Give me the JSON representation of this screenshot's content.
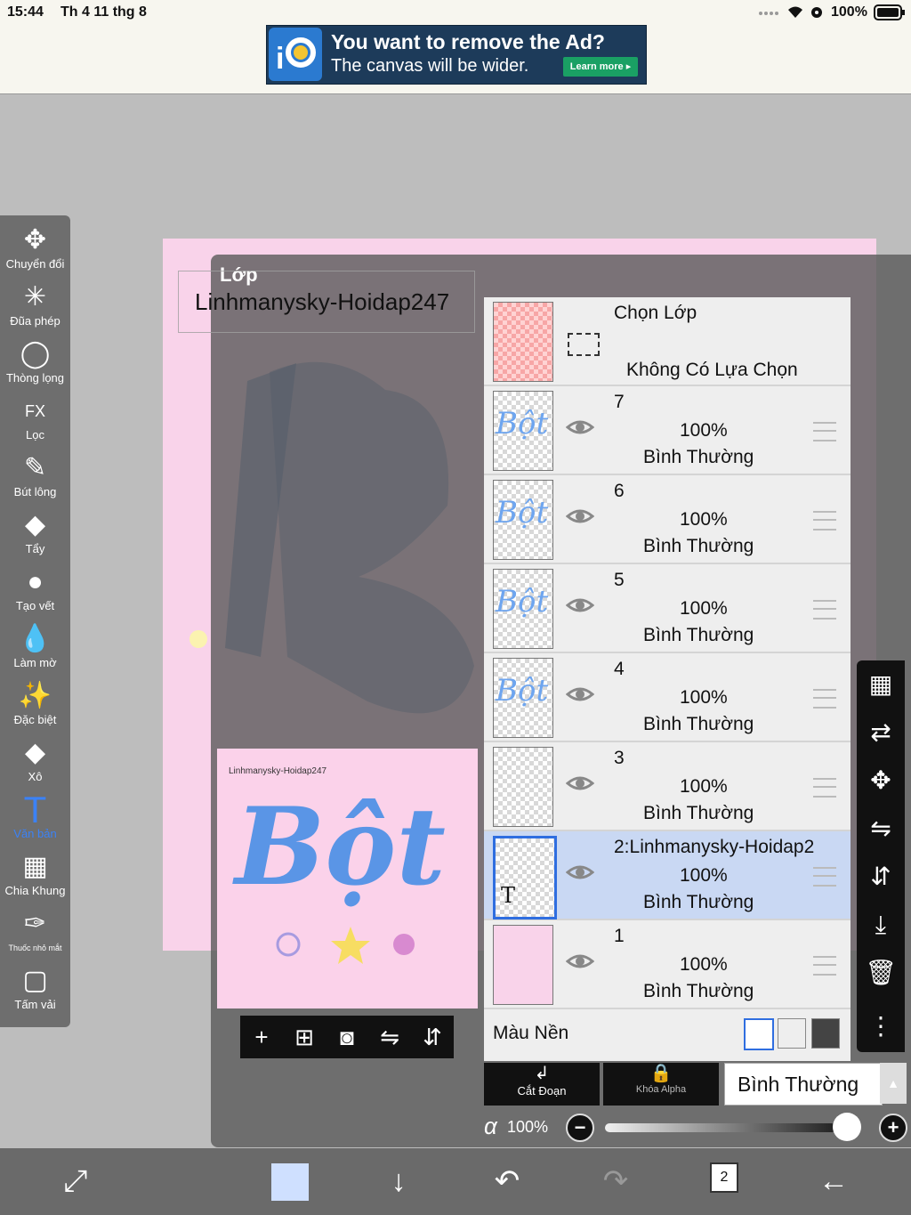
{
  "status": {
    "time": "15:44",
    "date": "Th 4 11 thg 8",
    "battery": "100%"
  },
  "ad": {
    "title": "You want to remove the Ad?",
    "subtitle": "The canvas will be wider.",
    "cta": "Learn more ▸",
    "logo_icon": "ibis-paint-logo-icon"
  },
  "toolbar": {
    "tools": [
      {
        "label": "Chuyển đổi",
        "icon": "move-icon",
        "glyph": "✥"
      },
      {
        "label": "Đũa phép",
        "icon": "magic-wand-icon",
        "glyph": "✳"
      },
      {
        "label": "Thòng lọng",
        "icon": "lasso-icon",
        "glyph": "◯"
      },
      {
        "label": "Lọc",
        "icon": "fx-filter-icon",
        "glyph": "FX"
      },
      {
        "label": "Bút lông",
        "icon": "brush-icon",
        "glyph": "✎"
      },
      {
        "label": "Tẩy",
        "icon": "eraser-icon",
        "glyph": "◆"
      },
      {
        "label": "Tạo vết",
        "icon": "smudge-icon",
        "glyph": "●"
      },
      {
        "label": "Làm mờ",
        "icon": "blur-drop-icon",
        "glyph": "💧"
      },
      {
        "label": "Đặc biệt",
        "icon": "special-icon",
        "glyph": "✨"
      },
      {
        "label": "Xô",
        "icon": "bucket-icon",
        "glyph": "◆"
      },
      {
        "label": "Văn bản",
        "icon": "text-tool-icon",
        "glyph": "T",
        "active": true
      },
      {
        "label": "Chia Khung",
        "icon": "frame-divider-icon",
        "glyph": "▦"
      },
      {
        "label": "Thuốc nhỏ mắt",
        "icon": "eyedropper-icon",
        "glyph": "✑"
      },
      {
        "label": "Tấm vải",
        "icon": "canvas-icon",
        "glyph": "▢"
      }
    ]
  },
  "panel": {
    "title": "Lớp",
    "layer_name": "Linhmanysky-Hoidap247",
    "preview_caption": "Linhmanysky-Hoidap247",
    "preview_word": "Bột",
    "actions": [
      "add-layer-icon",
      "add-copy-layer-icon",
      "camera-icon",
      "flip-horizontal-icon",
      "flip-vertical-icon"
    ],
    "selection": {
      "title": "Chọn Lớp",
      "status": "Không Có Lựa Chọn"
    },
    "layers": [
      {
        "name": "7",
        "opacity": "100%",
        "mode": "Bình Thường",
        "thumb": "Bột",
        "selected": false
      },
      {
        "name": "6",
        "opacity": "100%",
        "mode": "Bình Thường",
        "thumb": "Bột",
        "selected": false
      },
      {
        "name": "5",
        "opacity": "100%",
        "mode": "Bình Thường",
        "thumb": "Bột",
        "selected": false
      },
      {
        "name": "4",
        "opacity": "100%",
        "mode": "Bình Thường",
        "thumb": "Bột",
        "selected": false
      },
      {
        "name": "3",
        "opacity": "100%",
        "mode": "Bình Thường",
        "thumb": "",
        "selected": false
      },
      {
        "name": "2:Linhmanysky-Hoidap2",
        "opacity": "100%",
        "mode": "Bình Thường",
        "thumb": "T",
        "selected": true
      },
      {
        "name": "1",
        "opacity": "100%",
        "mode": "Bình Thường",
        "thumb": "",
        "selected": false
      }
    ],
    "background_label": "Màu Nền",
    "clip_label": "Cắt Đoạn",
    "alpha_lock_label": "Khóa Alpha",
    "blend_mode": "Bình Thường",
    "alpha_symbol": "α",
    "opacity": "100%"
  },
  "right_toolbar": [
    "checker-icon",
    "transfer-layer-icon",
    "move-layer-icon",
    "flip-h-layer-icon",
    "flip-v-layer-icon",
    "merge-down-icon",
    "trash-icon",
    "more-icon"
  ],
  "bottom_bar": {
    "page_count": "2",
    "color_swatch": "#cfe0ff"
  },
  "colors": {
    "accent_blue": "#2f6ee0",
    "canvas_pink": "#f9d3ea"
  }
}
